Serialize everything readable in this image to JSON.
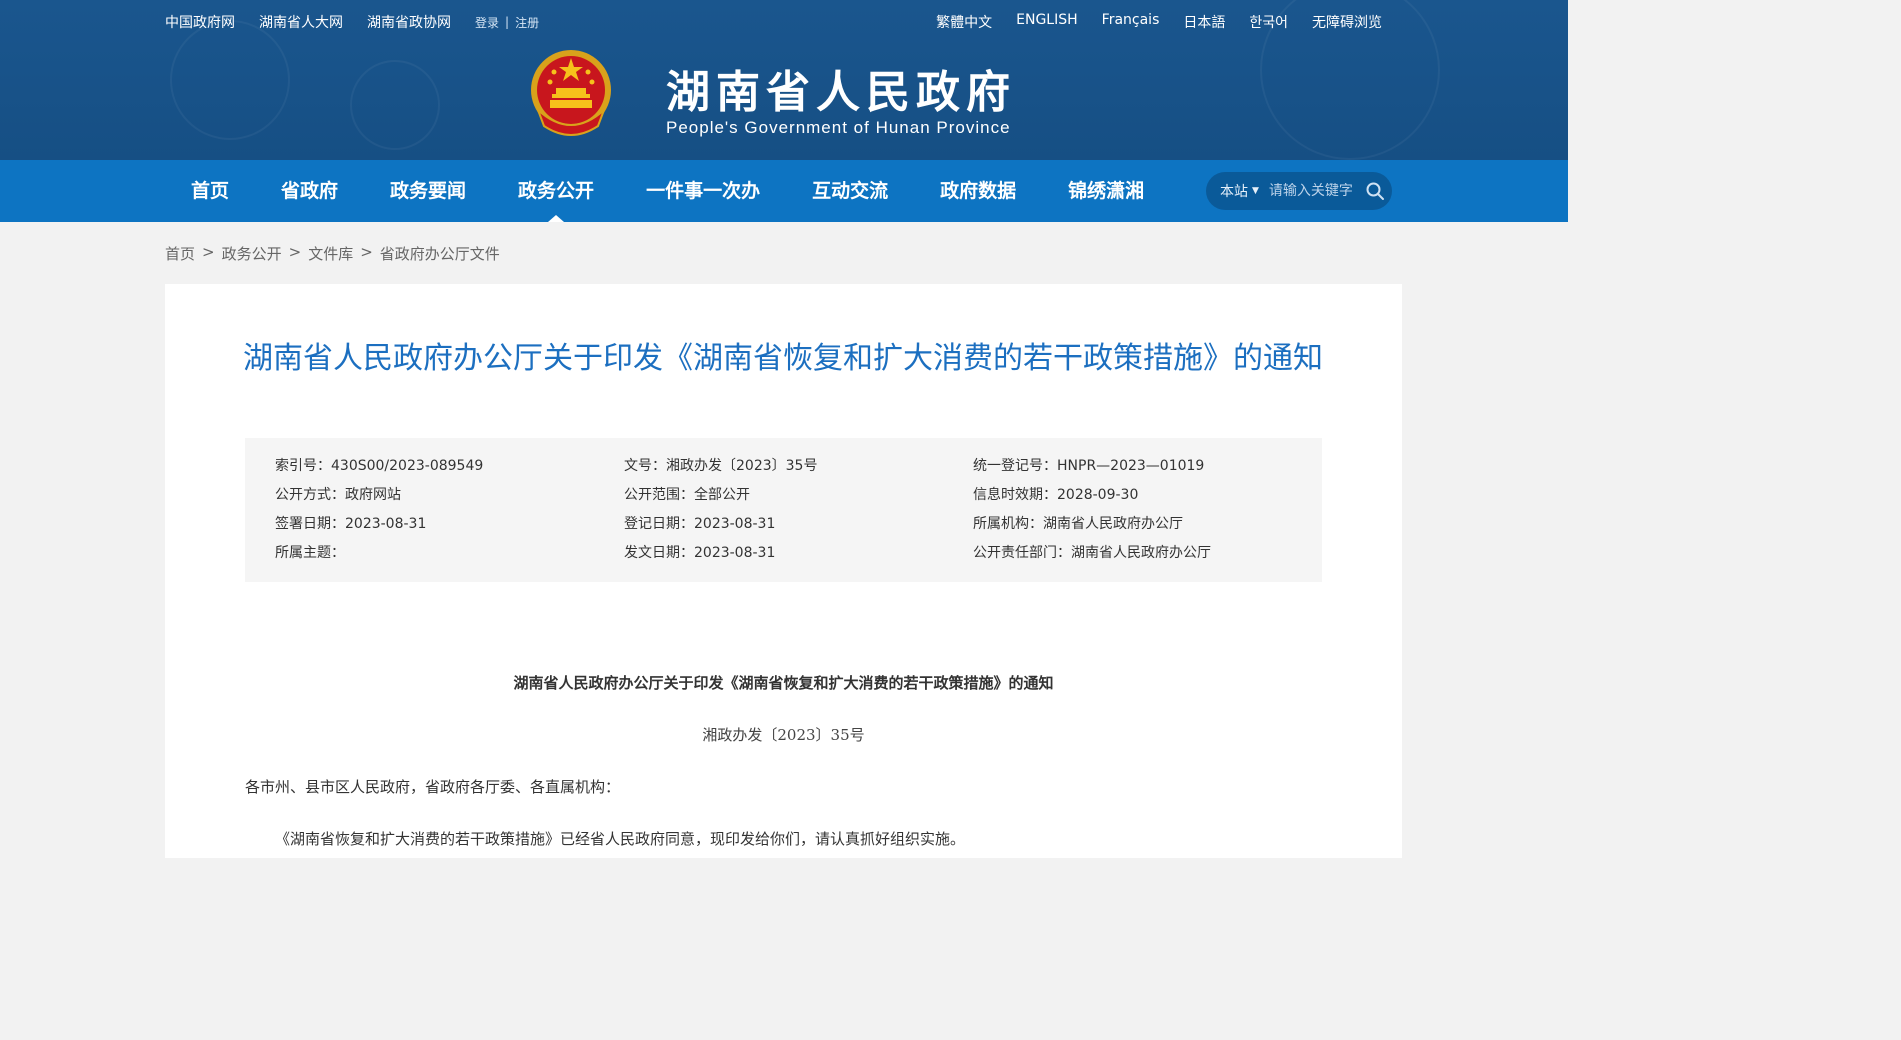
{
  "header": {
    "top_links": [
      "中国政府网",
      "湖南省人大网",
      "湖南省政协网"
    ],
    "login": "登录",
    "divider": "|",
    "register": "注册",
    "languages": [
      "繁體中文",
      "ENGLISH",
      "Français",
      "日本語",
      "한국어",
      "无障碍浏览"
    ],
    "site_title": "湖南省人民政府",
    "site_subtitle": "People's Government of Hunan Province",
    "colors": {
      "header_bg": "#1a568e",
      "nav_bg": "#0d74c2",
      "accent_title": "#1c6fc0"
    }
  },
  "nav": {
    "items": [
      "首页",
      "省政府",
      "政务要闻",
      "政务公开",
      "一件事一次办",
      "互动交流",
      "政府数据",
      "锦绣潇湘"
    ],
    "active": "政务公开",
    "search_scope": "本站",
    "search_placeholder": "请输入关键字"
  },
  "breadcrumb": [
    "首页",
    "政务公开",
    "文件库",
    "省政府办公厅文件"
  ],
  "breadcrumb_sep": ">",
  "document": {
    "title": "湖南省人民政府办公厅关于印发《湖南省恢复和扩大消费的若干政策措施》的通知",
    "meta": [
      [
        "索引号：430S00/2023-089549",
        "文号：湘政办发〔2023〕35号",
        "统一登记号：HNPR—2023—01019"
      ],
      [
        "公开方式：政府网站",
        "公开范围：全部公开",
        "信息时效期：2028-09-30"
      ],
      [
        "签署日期：2023-08-31",
        "登记日期：2023-08-31",
        "所属机构：湖南省人民政府办公厅"
      ],
      [
        "所属主题：",
        "发文日期：2023-08-31",
        "公开责任部门：湖南省人民政府办公厅"
      ]
    ],
    "body_title": "湖南省人民政府办公厅关于印发《湖南省恢复和扩大消费的若干政策措施》的通知",
    "doc_number": "湘政办发〔2023〕35号",
    "salutation": "各市州、县市区人民政府，省政府各厅委、各直属机构：",
    "paragraph": "《湖南省恢复和扩大消费的若干政策措施》已经省人民政府同意，现印发给你们，请认真抓好组织实施。"
  }
}
